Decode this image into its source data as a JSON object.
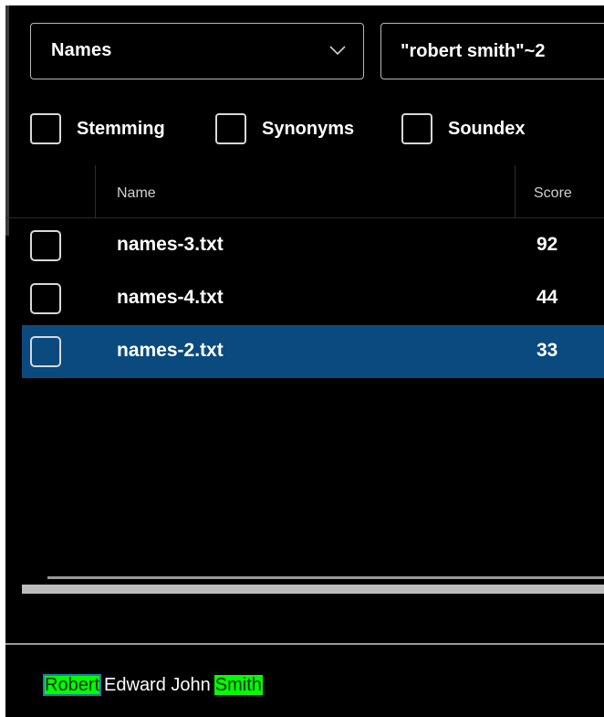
{
  "toolbar": {
    "field_selector": {
      "selected": "Names"
    },
    "query_input": {
      "value": "\"robert smith\"~2"
    }
  },
  "options": [
    {
      "label": "Stemming",
      "checked": false
    },
    {
      "label": "Synonyms",
      "checked": false
    },
    {
      "label": "Soundex",
      "checked": false
    }
  ],
  "results": {
    "columns": {
      "name": "Name",
      "score": "Score"
    },
    "rows": [
      {
        "name": "names-3.txt",
        "score": "92",
        "checked": false,
        "selected": false
      },
      {
        "name": "names-4.txt",
        "score": "44",
        "checked": false,
        "selected": false
      },
      {
        "name": "names-2.txt",
        "score": "33",
        "checked": false,
        "selected": true
      }
    ]
  },
  "preview": {
    "tokens": [
      {
        "text": "Robert",
        "highlight": true
      },
      {
        "text": "Edward John",
        "highlight": false
      },
      {
        "text": "Smith",
        "highlight": true
      }
    ]
  },
  "colors": {
    "selection": "#0a4a7e",
    "highlight": "#00ff00",
    "background": "#000000"
  }
}
